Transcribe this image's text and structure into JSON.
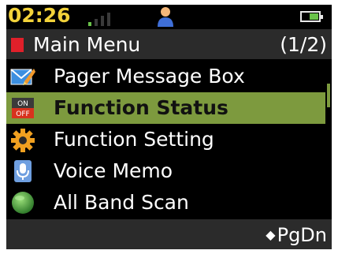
{
  "status": {
    "time": "02:26",
    "signal_level": 1,
    "signal_bars": 4,
    "battery_level": 0.5
  },
  "header": {
    "title": "Main Menu",
    "page": "(1/2)"
  },
  "menu": {
    "items": [
      {
        "label": "Pager Message Box",
        "icon": "envelope-icon",
        "selected": false
      },
      {
        "label": "Function Status",
        "icon": "on-off-icon",
        "selected": true
      },
      {
        "label": "Function Setting",
        "icon": "gear-icon",
        "selected": false
      },
      {
        "label": "Voice Memo",
        "icon": "microphone-icon",
        "selected": false
      },
      {
        "label": "All Band Scan",
        "icon": "globe-icon",
        "selected": false
      }
    ],
    "on_off_icon_text": {
      "on": "ON",
      "off": "OFF"
    }
  },
  "footer": {
    "softkey_label": "PgDn",
    "softkey_marker": "◆"
  },
  "colors": {
    "clock": "#f2d23a",
    "selection": "#7d9a3e",
    "title_marker": "#e0202a",
    "bar_background": "#2b2b2b",
    "battery_fill": "#6ac34a"
  }
}
